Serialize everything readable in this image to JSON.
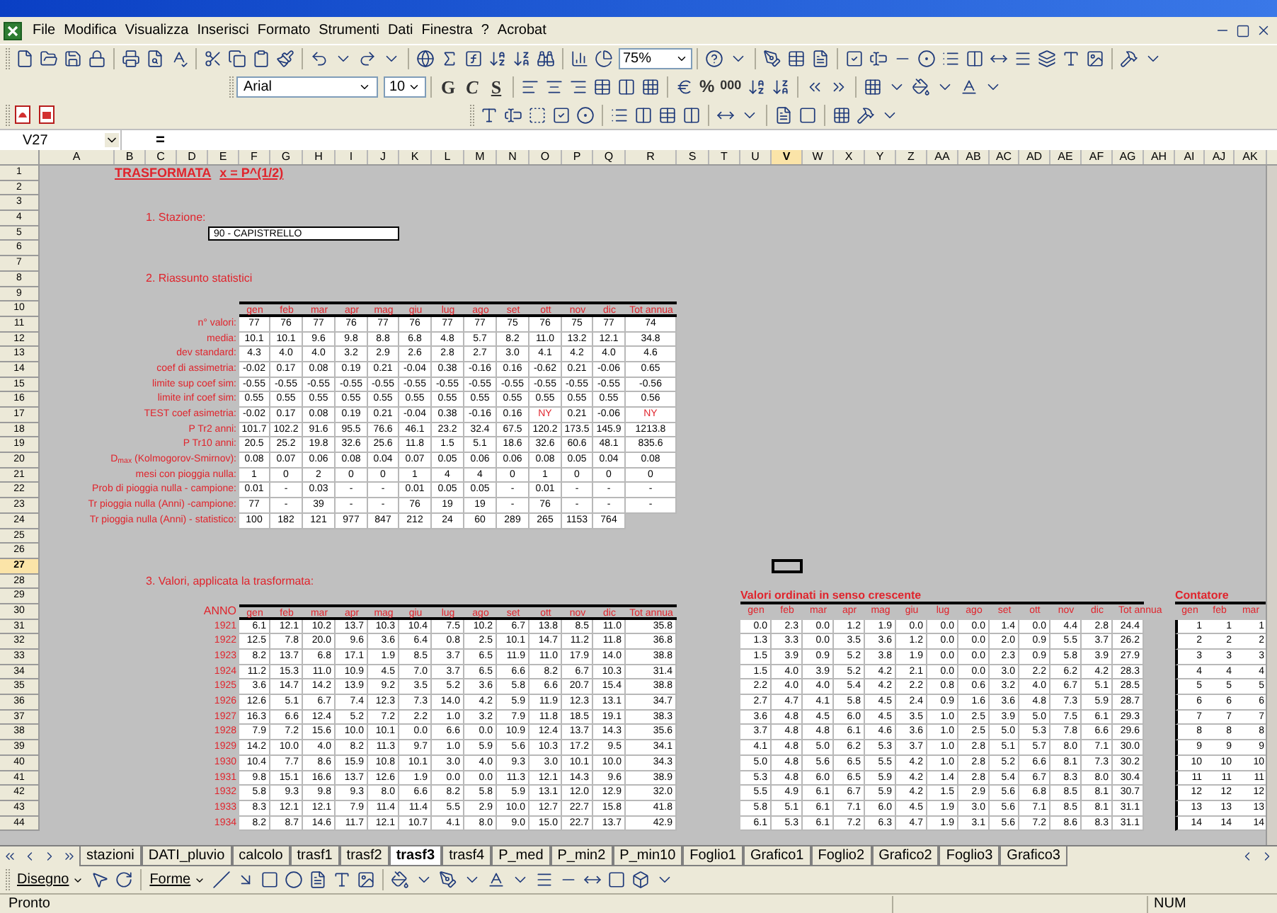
{
  "menu": {
    "items": [
      "File",
      "Modifica",
      "Visualizza",
      "Inserisci",
      "Formato",
      "Strumenti",
      "Dati",
      "Finestra",
      "?",
      "Acrobat"
    ]
  },
  "toolbar": {
    "zoom": "75%",
    "font": "Arial",
    "font_size": "10",
    "styles": [
      "G",
      "C",
      "S"
    ],
    "percent": "%",
    "thousands": "000"
  },
  "formula_bar": {
    "name_box": "V27",
    "equals": "="
  },
  "columns": [
    {
      "label": "A",
      "selected": false
    },
    {
      "label": "B",
      "selected": false
    },
    {
      "label": "C",
      "selected": false
    },
    {
      "label": "D",
      "selected": false
    },
    {
      "label": "E",
      "selected": false
    },
    {
      "label": "F",
      "selected": false
    },
    {
      "label": "G",
      "selected": false
    },
    {
      "label": "H",
      "selected": false
    },
    {
      "label": "I",
      "selected": false
    },
    {
      "label": "J",
      "selected": false
    },
    {
      "label": "K",
      "selected": false
    },
    {
      "label": "L",
      "selected": false
    },
    {
      "label": "M",
      "selected": false
    },
    {
      "label": "N",
      "selected": false
    },
    {
      "label": "O",
      "selected": false
    },
    {
      "label": "P",
      "selected": false
    },
    {
      "label": "Q",
      "selected": false
    },
    {
      "label": "R",
      "selected": false
    },
    {
      "label": "S",
      "selected": false
    },
    {
      "label": "T",
      "selected": false
    },
    {
      "label": "U",
      "selected": false
    },
    {
      "label": "V",
      "selected": true
    },
    {
      "label": "W",
      "selected": false
    },
    {
      "label": "X",
      "selected": false
    },
    {
      "label": "Y",
      "selected": false
    },
    {
      "label": "Z",
      "selected": false
    },
    {
      "label": "AA",
      "selected": false
    },
    {
      "label": "AB",
      "selected": false
    },
    {
      "label": "AC",
      "selected": false
    },
    {
      "label": "AD",
      "selected": false
    },
    {
      "label": "AE",
      "selected": false
    },
    {
      "label": "AF",
      "selected": false
    },
    {
      "label": "AG",
      "selected": false
    },
    {
      "label": "AH",
      "selected": false
    },
    {
      "label": "AI",
      "selected": false
    },
    {
      "label": "AJ",
      "selected": false
    },
    {
      "label": "AK",
      "selected": false
    }
  ],
  "row_numbers": [
    {
      "label": "1",
      "selected": false
    },
    {
      "label": "2",
      "selected": false
    },
    {
      "label": "3",
      "selected": false
    },
    {
      "label": "4",
      "selected": false
    },
    {
      "label": "5",
      "selected": false
    },
    {
      "label": "6",
      "selected": false
    },
    {
      "label": "7",
      "selected": false
    },
    {
      "label": "8",
      "selected": false
    },
    {
      "label": "9",
      "selected": false
    },
    {
      "label": "10",
      "selected": false
    },
    {
      "label": "11",
      "selected": false
    },
    {
      "label": "12",
      "selected": false
    },
    {
      "label": "13",
      "selected": false
    },
    {
      "label": "14",
      "selected": false
    },
    {
      "label": "15",
      "selected": false
    },
    {
      "label": "16",
      "selected": false
    },
    {
      "label": "17",
      "selected": false
    },
    {
      "label": "18",
      "selected": false
    },
    {
      "label": "19",
      "selected": false
    },
    {
      "label": "20",
      "selected": false
    },
    {
      "label": "21",
      "selected": false
    },
    {
      "label": "22",
      "selected": false
    },
    {
      "label": "23",
      "selected": false
    },
    {
      "label": "24",
      "selected": false
    },
    {
      "label": "25",
      "selected": false
    },
    {
      "label": "26",
      "selected": false
    },
    {
      "label": "27",
      "selected": true
    },
    {
      "label": "28",
      "selected": false
    },
    {
      "label": "29",
      "selected": false
    },
    {
      "label": "30",
      "selected": false
    },
    {
      "label": "31",
      "selected": false
    },
    {
      "label": "32",
      "selected": false
    },
    {
      "label": "33",
      "selected": false
    },
    {
      "label": "34",
      "selected": false
    },
    {
      "label": "35",
      "selected": false
    },
    {
      "label": "36",
      "selected": false
    },
    {
      "label": "37",
      "selected": false
    },
    {
      "label": "38",
      "selected": false
    },
    {
      "label": "39",
      "selected": false
    },
    {
      "label": "40",
      "selected": false
    },
    {
      "label": "41",
      "selected": false
    },
    {
      "label": "42",
      "selected": false
    },
    {
      "label": "43",
      "selected": false
    },
    {
      "label": "44",
      "selected": false
    }
  ],
  "sheet": {
    "title": "TRASFORMATA",
    "formula": "x = P^(1/2)",
    "station_heading": "1. Stazione:",
    "station": "90 - CAPISTRELLO",
    "stats_heading": "2. Riassunto statistici",
    "stats": {
      "columns": [
        "gen",
        "feb",
        "mar",
        "apr",
        "mag",
        "giu",
        "lug",
        "ago",
        "set",
        "ott",
        "nov",
        "dic",
        "Tot annua"
      ],
      "rows": [
        {
          "label": "n° valori:",
          "values": [
            "77",
            "76",
            "77",
            "76",
            "77",
            "76",
            "77",
            "77",
            "75",
            "76",
            "75",
            "77",
            "74"
          ]
        },
        {
          "label": "media:",
          "values": [
            "10.1",
            "10.1",
            "9.6",
            "9.8",
            "8.8",
            "6.8",
            "4.8",
            "5.7",
            "8.2",
            "11.0",
            "13.2",
            "12.1",
            "34.8"
          ]
        },
        {
          "label": "dev standard:",
          "values": [
            "4.3",
            "4.0",
            "4.0",
            "3.2",
            "2.9",
            "2.6",
            "2.8",
            "2.7",
            "3.0",
            "4.1",
            "4.2",
            "4.0",
            "4.6"
          ]
        },
        {
          "label": "coef di assimetria:",
          "values": [
            "-0.02",
            "0.17",
            "0.08",
            "0.19",
            "0.21",
            "-0.04",
            "0.38",
            "-0.16",
            "0.16",
            "-0.62",
            "0.21",
            "-0.06",
            "0.65"
          ]
        },
        {
          "label": "limite sup coef sim:",
          "values": [
            "-0.55",
            "-0.55",
            "-0.55",
            "-0.55",
            "-0.55",
            "-0.55",
            "-0.55",
            "-0.55",
            "-0.55",
            "-0.55",
            "-0.55",
            "-0.55",
            "-0.56"
          ]
        },
        {
          "label": "limite inf coef sim:",
          "values": [
            "0.55",
            "0.55",
            "0.55",
            "0.55",
            "0.55",
            "0.55",
            "0.55",
            "0.55",
            "0.55",
            "0.55",
            "0.55",
            "0.55",
            "0.56"
          ]
        },
        {
          "label": "TEST coef asimetria:",
          "values": [
            "-0.02",
            "0.17",
            "0.08",
            "0.19",
            "0.21",
            "-0.04",
            "0.38",
            "-0.16",
            "0.16",
            "NY",
            "0.21",
            "-0.06",
            "NY"
          ],
          "failed": [
            false,
            false,
            false,
            false,
            false,
            false,
            false,
            false,
            false,
            true,
            false,
            false,
            true
          ]
        },
        {
          "label": "P Tr2 anni:",
          "values": [
            "101.7",
            "102.2",
            "91.6",
            "95.5",
            "76.6",
            "46.1",
            "23.2",
            "32.4",
            "67.5",
            "120.2",
            "173.5",
            "145.9",
            "1213.8"
          ]
        },
        {
          "label": "P Tr10 anni:",
          "values": [
            "20.5",
            "25.2",
            "19.8",
            "32.6",
            "25.6",
            "11.8",
            "1.5",
            "5.1",
            "18.6",
            "32.6",
            "60.6",
            "48.1",
            "835.6"
          ]
        },
        {
          "label": "D$_{max}$ (Kolmogorov-Smirnov):",
          "values": [
            "0.08",
            "0.07",
            "0.06",
            "0.08",
            "0.04",
            "0.07",
            "0.05",
            "0.06",
            "0.06",
            "0.08",
            "0.05",
            "0.04",
            "0.08"
          ]
        },
        {
          "label": "mesi con pioggia nulla:",
          "values": [
            "1",
            "0",
            "2",
            "0",
            "0",
            "1",
            "4",
            "4",
            "0",
            "1",
            "0",
            "0",
            "0"
          ]
        },
        {
          "label": "Prob di pioggia nulla - campione:",
          "values": [
            "0.01",
            "-",
            "0.03",
            "-",
            "-",
            "0.01",
            "0.05",
            "0.05",
            "-",
            "0.01",
            "-",
            "-",
            "-"
          ]
        },
        {
          "label": "Tr pioggia nulla (Anni) -campione:",
          "values": [
            "77",
            "-",
            "39",
            "-",
            "-",
            "76",
            "19",
            "19",
            "-",
            "76",
            "-",
            "-",
            "-"
          ]
        },
        {
          "label": "Tr pioggia nulla (Anni) - statistico:",
          "values": [
            "100",
            "182",
            "121",
            "977",
            "847",
            "212",
            "24",
            "60",
            "289",
            "265",
            "1153",
            "764"
          ]
        }
      ]
    },
    "values_heading": "3. Valori, applicata la trasformata:",
    "values_table": {
      "year_header": "ANNO",
      "columns": [
        "gen",
        "feb",
        "mar",
        "apr",
        "mag",
        "giu",
        "lug",
        "ago",
        "set",
        "ott",
        "nov",
        "dic",
        "Tot annua"
      ],
      "rows": [
        {
          "year": "1921",
          "values": [
            "6.1",
            "12.1",
            "10.2",
            "13.7",
            "10.3",
            "10.4",
            "7.5",
            "10.2",
            "6.7",
            "13.8",
            "8.5",
            "11.0",
            "35.8"
          ]
        },
        {
          "year": "1922",
          "values": [
            "12.5",
            "7.8",
            "20.0",
            "9.6",
            "3.6",
            "6.4",
            "0.8",
            "2.5",
            "10.1",
            "14.7",
            "11.2",
            "11.8",
            "36.8"
          ]
        },
        {
          "year": "1923",
          "values": [
            "8.2",
            "13.7",
            "6.8",
            "17.1",
            "1.9",
            "8.5",
            "3.7",
            "6.5",
            "11.9",
            "11.0",
            "17.9",
            "14.0",
            "38.8"
          ]
        },
        {
          "year": "1924",
          "values": [
            "11.2",
            "15.3",
            "11.0",
            "10.9",
            "4.5",
            "7.0",
            "3.7",
            "6.5",
            "6.6",
            "8.2",
            "6.7",
            "10.3",
            "31.4"
          ]
        },
        {
          "year": "1925",
          "values": [
            "3.6",
            "14.7",
            "14.2",
            "13.9",
            "9.2",
            "3.5",
            "5.2",
            "3.6",
            "5.8",
            "6.6",
            "20.7",
            "15.4",
            "38.8"
          ]
        },
        {
          "year": "1926",
          "values": [
            "12.6",
            "5.1",
            "6.7",
            "7.4",
            "12.3",
            "7.3",
            "14.0",
            "4.2",
            "5.9",
            "11.9",
            "12.3",
            "13.1",
            "34.7"
          ]
        },
        {
          "year": "1927",
          "values": [
            "16.3",
            "6.6",
            "12.4",
            "5.2",
            "7.2",
            "2.2",
            "1.0",
            "3.2",
            "7.9",
            "11.8",
            "18.5",
            "19.1",
            "38.3"
          ]
        },
        {
          "year": "1928",
          "values": [
            "7.9",
            "7.2",
            "15.6",
            "10.0",
            "10.1",
            "0.0",
            "6.6",
            "0.0",
            "10.9",
            "12.4",
            "13.7",
            "14.3",
            "35.6"
          ]
        },
        {
          "year": "1929",
          "values": [
            "14.2",
            "10.0",
            "4.0",
            "8.2",
            "11.3",
            "9.7",
            "1.0",
            "5.9",
            "5.6",
            "10.3",
            "17.2",
            "9.5",
            "34.1"
          ]
        },
        {
          "year": "1930",
          "values": [
            "10.4",
            "7.7",
            "8.6",
            "15.9",
            "10.8",
            "10.1",
            "3.0",
            "4.0",
            "9.3",
            "3.0",
            "10.1",
            "10.0",
            "34.3"
          ]
        },
        {
          "year": "1931",
          "values": [
            "9.8",
            "15.1",
            "16.6",
            "13.7",
            "12.6",
            "1.9",
            "0.0",
            "0.0",
            "11.3",
            "12.1",
            "14.3",
            "9.6",
            "38.9"
          ]
        },
        {
          "year": "1932",
          "values": [
            "5.8",
            "9.3",
            "9.8",
            "9.3",
            "8.0",
            "6.6",
            "8.2",
            "5.8",
            "5.9",
            "13.1",
            "12.0",
            "12.9",
            "32.0"
          ]
        },
        {
          "year": "1933",
          "values": [
            "8.3",
            "12.1",
            "12.1",
            "7.9",
            "11.4",
            "11.4",
            "5.5",
            "2.9",
            "10.0",
            "12.7",
            "22.7",
            "15.8",
            "41.8"
          ]
        },
        {
          "year": "1934",
          "values": [
            "8.2",
            "8.7",
            "14.6",
            "11.7",
            "12.1",
            "10.7",
            "4.1",
            "8.0",
            "9.0",
            "15.0",
            "22.7",
            "13.7",
            "42.9"
          ]
        }
      ]
    },
    "sorted_table": {
      "title": "Valori ordinati in senso crescente",
      "columns": [
        "gen",
        "feb",
        "mar",
        "apr",
        "mag",
        "giu",
        "lug",
        "ago",
        "set",
        "ott",
        "nov",
        "dic",
        "Tot annua"
      ],
      "rows": [
        [
          "0.0",
          "2.3",
          "0.0",
          "1.2",
          "1.9",
          "0.0",
          "0.0",
          "0.0",
          "1.4",
          "0.0",
          "4.4",
          "2.8",
          "24.4"
        ],
        [
          "1.3",
          "3.3",
          "0.0",
          "3.5",
          "3.6",
          "1.2",
          "0.0",
          "0.0",
          "2.0",
          "0.9",
          "5.5",
          "3.7",
          "26.2"
        ],
        [
          "1.5",
          "3.9",
          "0.9",
          "5.2",
          "3.8",
          "1.9",
          "0.0",
          "0.0",
          "2.3",
          "0.9",
          "5.8",
          "3.9",
          "27.9"
        ],
        [
          "1.5",
          "4.0",
          "3.9",
          "5.2",
          "4.2",
          "2.1",
          "0.0",
          "0.0",
          "3.0",
          "2.2",
          "6.2",
          "4.2",
          "28.3"
        ],
        [
          "2.2",
          "4.0",
          "4.0",
          "5.4",
          "4.2",
          "2.2",
          "0.8",
          "0.6",
          "3.2",
          "4.0",
          "6.7",
          "5.1",
          "28.5"
        ],
        [
          "2.7",
          "4.7",
          "4.1",
          "5.8",
          "4.5",
          "2.4",
          "0.9",
          "1.6",
          "3.6",
          "4.8",
          "7.3",
          "5.9",
          "28.7"
        ],
        [
          "3.6",
          "4.8",
          "4.5",
          "6.0",
          "4.5",
          "3.5",
          "1.0",
          "2.5",
          "3.9",
          "5.0",
          "7.5",
          "6.1",
          "29.3"
        ],
        [
          "3.7",
          "4.8",
          "4.8",
          "6.1",
          "4.6",
          "3.6",
          "1.0",
          "2.5",
          "5.0",
          "5.3",
          "7.8",
          "6.6",
          "29.6"
        ],
        [
          "4.1",
          "4.8",
          "5.0",
          "6.2",
          "5.3",
          "3.7",
          "1.0",
          "2.8",
          "5.1",
          "5.7",
          "8.0",
          "7.1",
          "30.0"
        ],
        [
          "5.0",
          "4.8",
          "5.6",
          "6.5",
          "5.5",
          "4.2",
          "1.0",
          "2.8",
          "5.2",
          "6.6",
          "8.1",
          "7.3",
          "30.2"
        ],
        [
          "5.3",
          "4.8",
          "6.0",
          "6.5",
          "5.9",
          "4.2",
          "1.4",
          "2.8",
          "5.4",
          "6.7",
          "8.3",
          "8.0",
          "30.4"
        ],
        [
          "5.5",
          "4.9",
          "6.1",
          "6.7",
          "5.9",
          "4.2",
          "1.5",
          "2.9",
          "5.6",
          "6.8",
          "8.5",
          "8.1",
          "30.7"
        ],
        [
          "5.8",
          "5.1",
          "6.1",
          "7.1",
          "6.0",
          "4.5",
          "1.9",
          "3.0",
          "5.6",
          "7.1",
          "8.5",
          "8.1",
          "31.1"
        ],
        [
          "6.1",
          "5.3",
          "6.1",
          "7.2",
          "6.3",
          "4.7",
          "1.9",
          "3.1",
          "5.6",
          "7.2",
          "8.6",
          "8.3",
          "31.1"
        ]
      ]
    },
    "counter_table": {
      "title": "Contatore",
      "columns": [
        "gen",
        "feb",
        "mar"
      ],
      "rows": [
        [
          "1",
          "1",
          "1"
        ],
        [
          "2",
          "2",
          "2"
        ],
        [
          "3",
          "3",
          "3"
        ],
        [
          "4",
          "4",
          "4"
        ],
        [
          "5",
          "5",
          "5"
        ],
        [
          "6",
          "6",
          "6"
        ],
        [
          "7",
          "7",
          "7"
        ],
        [
          "8",
          "8",
          "8"
        ],
        [
          "9",
          "9",
          "9"
        ],
        [
          "10",
          "10",
          "10"
        ],
        [
          "11",
          "11",
          "11"
        ],
        [
          "12",
          "12",
          "12"
        ],
        [
          "13",
          "13",
          "13"
        ],
        [
          "14",
          "14",
          "14"
        ]
      ]
    }
  },
  "sheet_tabs": [
    {
      "label": "stazioni",
      "selected": false
    },
    {
      "label": "DATI_pluvio",
      "selected": false
    },
    {
      "label": "calcolo",
      "selected": false
    },
    {
      "label": "trasf1",
      "selected": false
    },
    {
      "label": "trasf2",
      "selected": false
    },
    {
      "label": "trasf3",
      "selected": true
    },
    {
      "label": "trasf4",
      "selected": false
    },
    {
      "label": "P_med",
      "selected": false
    },
    {
      "label": "P_min2",
      "selected": false
    },
    {
      "label": "P_min10",
      "selected": false
    },
    {
      "label": "Foglio1",
      "selected": false
    },
    {
      "label": "Grafico1",
      "selected": false
    },
    {
      "label": "Foglio2",
      "selected": false
    },
    {
      "label": "Grafico2",
      "selected": false
    },
    {
      "label": "Foglio3",
      "selected": false
    },
    {
      "label": "Grafico3",
      "selected": false
    }
  ],
  "drawing_toolbar": {
    "draw": "Disegno",
    "shapes": "Forme"
  },
  "status_bar": {
    "status": "Pronto",
    "num": "NUM"
  }
}
